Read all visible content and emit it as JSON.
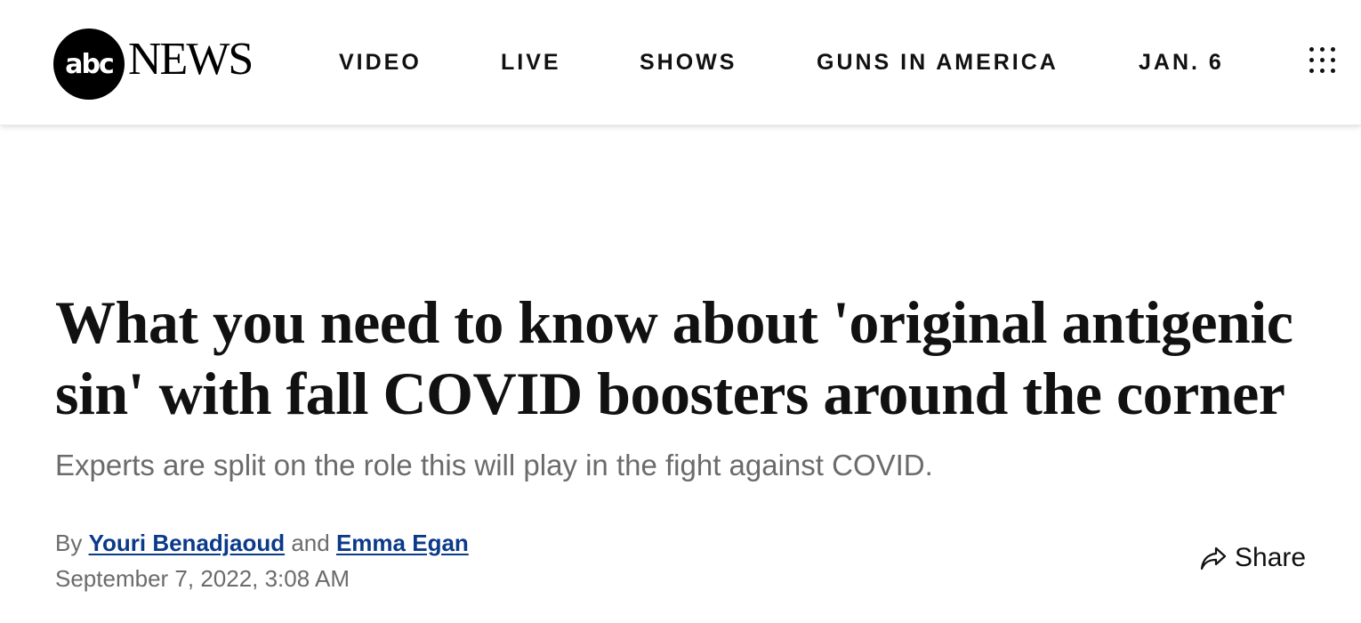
{
  "header": {
    "logo": {
      "abc_text": "abc",
      "news_text": "NEWS"
    },
    "nav_items": [
      {
        "label": "VIDEO"
      },
      {
        "label": "LIVE"
      },
      {
        "label": "SHOWS"
      },
      {
        "label": "GUNS IN AMERICA"
      },
      {
        "label": "JAN. 6"
      }
    ],
    "menu_icon": "grid-dots-icon"
  },
  "article": {
    "headline": "What you need to know about 'original antigenic sin' with fall COVID boosters around the corner",
    "subheadline": "Experts are split on the role this will play in the fight against COVID.",
    "byline": {
      "by_label": "By",
      "author_1": "Youri Benadjaoud",
      "and_label": "and",
      "author_2": "Emma Egan"
    },
    "date": "September 7, 2022, 3:08 AM",
    "share": {
      "label": "Share",
      "icon": "share-arrow-icon"
    }
  },
  "colors": {
    "author_link": "#0b3a8a",
    "muted_text": "#6b6b6b",
    "headline_text": "#111111"
  }
}
